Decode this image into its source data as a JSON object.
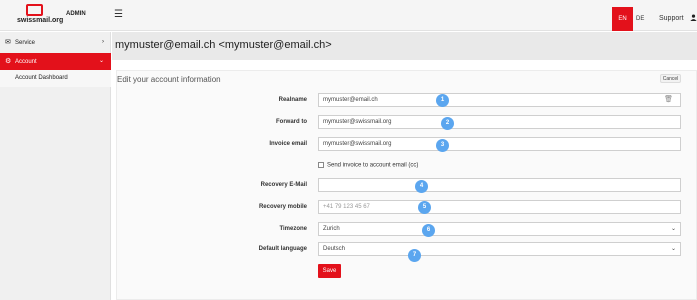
{
  "brand": {
    "logo_text": "swissmail.org",
    "admin_label": "ADMIN"
  },
  "topbar": {
    "menu_icon": "hamburger-icon",
    "lang_en": "EN",
    "lang_de": "DE",
    "support": "Support",
    "user_icon": "user-icon"
  },
  "sidebar": {
    "items": [
      {
        "label": "Service",
        "icon": "envelope-icon"
      },
      {
        "label": "Account",
        "icon": "gear-icon"
      },
      {
        "label": "Account Dashboard"
      }
    ]
  },
  "page": {
    "title": "mymuster@email.ch <mymuster@email.ch>"
  },
  "form": {
    "heading": "Edit your account information",
    "cancel_label": "Cancel",
    "realname_label": "Realname",
    "realname_value": "mymuster@email.ch",
    "forward_label": "Forward to",
    "forward_value": "mymuster@swissmail.org",
    "invoice_label": "Invoice email",
    "invoice_value": "mymuster@swissmail.org",
    "send_invoice_label": "Send invoice to account email (cc)",
    "recovery_email_label": "Recovery E-Mail",
    "recovery_email_value": "",
    "recovery_mobile_label": "Recovery mobile",
    "recovery_mobile_placeholder": "+41 79 123 45 67",
    "timezone_label": "Timezone",
    "timezone_value": "Zurich",
    "language_label": "Default language",
    "language_value": "Deutsch",
    "save_label": "Save"
  },
  "badges": [
    "1",
    "2",
    "3",
    "4",
    "5",
    "6",
    "7"
  ],
  "colors": {
    "accent": "#e3111b",
    "badge": "#5ba6ef"
  }
}
